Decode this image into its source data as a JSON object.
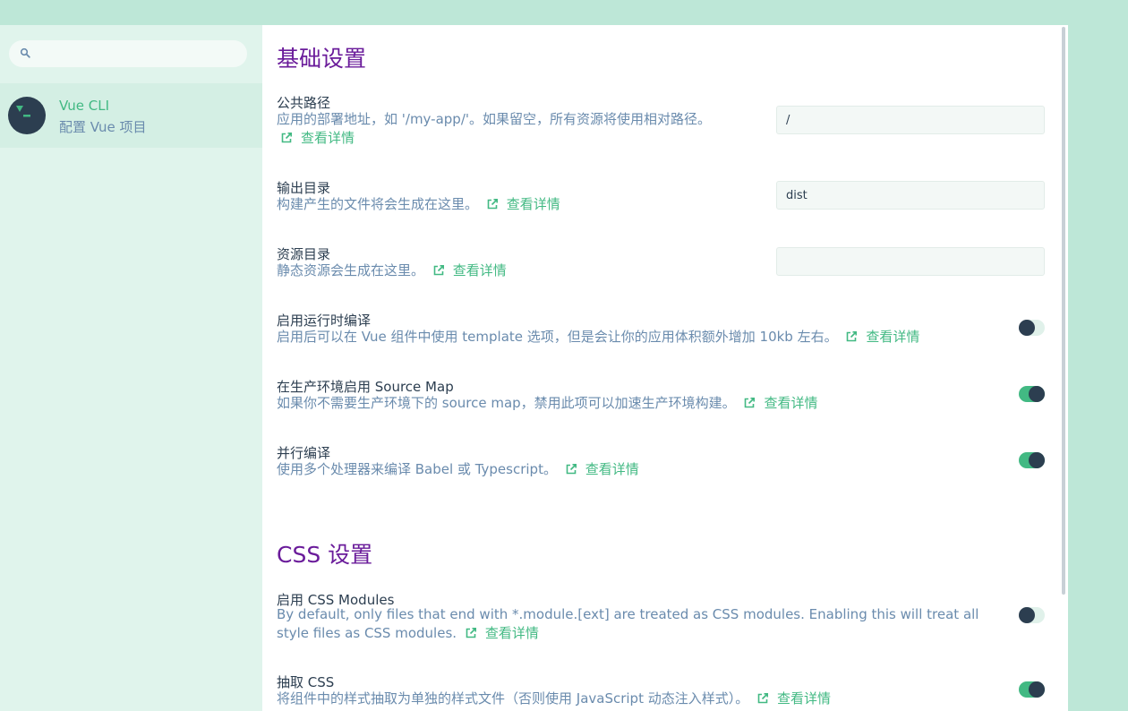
{
  "sidebar": {
    "search": {
      "placeholder": "",
      "value": ""
    },
    "project": {
      "name": "Vue CLI",
      "subtitle": "配置 Vue 项目"
    }
  },
  "more_label": "查看详情",
  "sections": {
    "basic": {
      "title": "基础设置",
      "public_path": {
        "title": "公共路径",
        "desc": "应用的部署地址，如 '/my-app/'。如果留空，所有资源将使用相对路径。",
        "value": "/"
      },
      "output_dir": {
        "title": "输出目录",
        "desc": "构建产生的文件将会生成在这里。",
        "value": "dist"
      },
      "assets_dir": {
        "title": "资源目录",
        "desc": "静态资源会生成在这里。",
        "value": ""
      },
      "runtime_compiler": {
        "title": "启用运行时编译",
        "desc": "启用后可以在 Vue 组件中使用 template 选项，但是会让你的应用体积额外增加 10kb 左右。",
        "enabled": false
      },
      "source_map": {
        "title": "在生产环境启用 Source Map",
        "desc": "如果你不需要生产环境下的 source map，禁用此项可以加速生产环境构建。",
        "enabled": true
      },
      "parallel": {
        "title": "并行编译",
        "desc": "使用多个处理器来编译 Babel 或 Typescript。",
        "enabled": true
      }
    },
    "css": {
      "title": "CSS 设置",
      "css_modules": {
        "title": "启用 CSS Modules",
        "desc": "By default, only files that end with *.module.[ext] are treated as CSS modules. Enabling this will treat all style files as CSS modules.",
        "enabled": false
      },
      "extract_css": {
        "title": "抽取 CSS",
        "desc": "将组件中的样式抽取为单独的样式文件（否则使用 JavaScript 动态注入样式）。",
        "enabled": true
      }
    }
  },
  "colors": {
    "accent": "#42b983",
    "title": "#6a1b9a",
    "text": "#2c3e50",
    "muted": "#6a8bad",
    "background": "#bde7d7"
  }
}
